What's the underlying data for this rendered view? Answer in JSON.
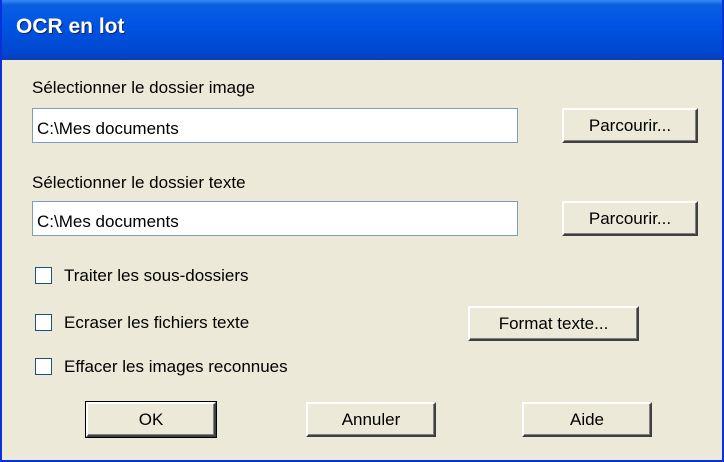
{
  "window": {
    "title": "OCR en lot"
  },
  "image_folder": {
    "label": "Sélectionner le dossier image",
    "value": "C:\\Mes documents",
    "browse_label": "Parcourir..."
  },
  "text_folder": {
    "label": "Sélectionner le dossier texte",
    "value": "C:\\Mes documents",
    "browse_label": "Parcourir..."
  },
  "options": {
    "subfolders": {
      "label": "Traiter les sous-dossiers",
      "checked": false
    },
    "overwrite": {
      "label": "Ecraser les fichiers texte",
      "checked": false
    },
    "delete_images": {
      "label": "Effacer les images reconnues",
      "checked": false
    }
  },
  "format_label": "Format texte...",
  "footer": {
    "ok_label": "OK",
    "cancel_label": "Annuler",
    "help_label": "Aide"
  },
  "colors": {
    "titlebar": "#0054e3",
    "dialog_bg": "#ece9d8",
    "frame": "#0831d9"
  }
}
